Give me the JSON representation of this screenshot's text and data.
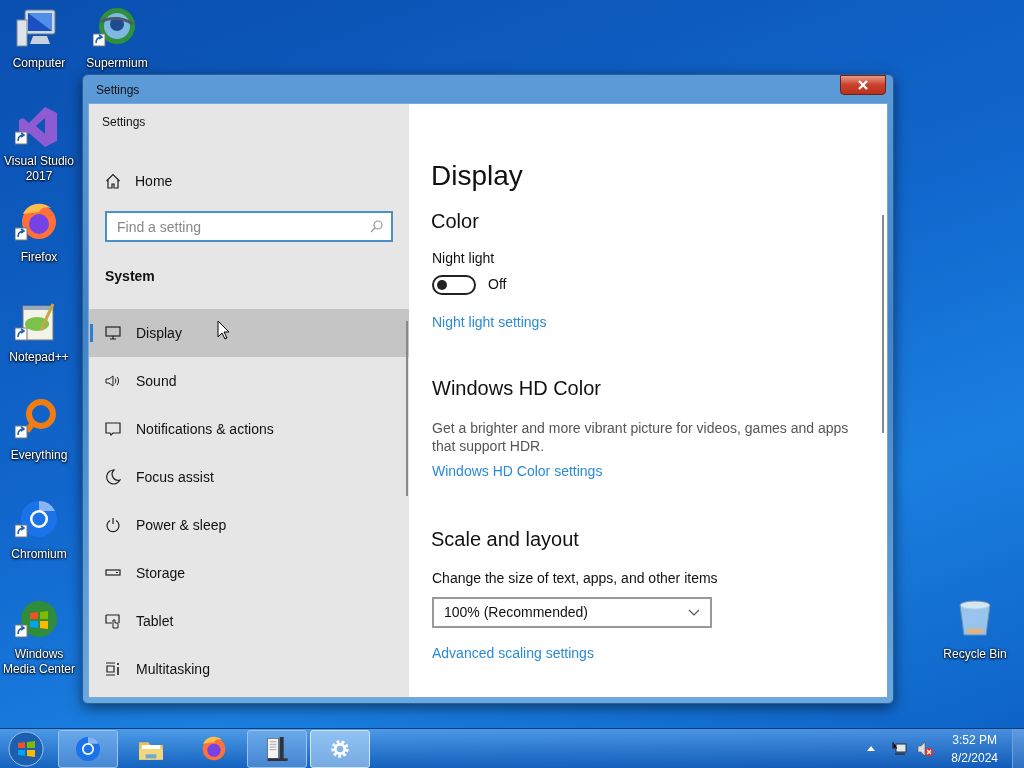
{
  "desktop_icons": [
    {
      "kind": "computer",
      "label": "Computer",
      "shortcut": false
    },
    {
      "kind": "globe",
      "label": "Supermium",
      "shortcut": true
    },
    {
      "kind": "vs",
      "label": "Visual Studio 2017",
      "shortcut": true
    },
    {
      "kind": "firefox",
      "label": "Firefox",
      "shortcut": true
    },
    {
      "kind": "notepad",
      "label": "Notepad++",
      "shortcut": true
    },
    {
      "kind": "ring",
      "label": "Everything",
      "shortcut": true
    },
    {
      "kind": "chromium",
      "label": "Chromium",
      "shortcut": true
    },
    {
      "kind": "wmc",
      "label": "Windows Media Center",
      "shortcut": true
    },
    {
      "kind": "bin",
      "label": "Recycle Bin",
      "shortcut": false
    }
  ],
  "window": {
    "title": "Settings",
    "app_title": "Settings",
    "home": "Home",
    "search": {
      "placeholder": "Find a setting"
    },
    "group": "System",
    "nav_items": [
      {
        "kind": "display",
        "label": "Display",
        "selected": true
      },
      {
        "kind": "sound",
        "label": "Sound",
        "selected": false
      },
      {
        "kind": "notifications",
        "label": "Notifications & actions",
        "selected": false
      },
      {
        "kind": "focus",
        "label": "Focus assist",
        "selected": false
      },
      {
        "kind": "power",
        "label": "Power & sleep",
        "selected": false
      },
      {
        "kind": "storage",
        "label": "Storage",
        "selected": false
      },
      {
        "kind": "tablet",
        "label": "Tablet",
        "selected": false
      },
      {
        "kind": "multitasking",
        "label": "Multitasking",
        "selected": false
      }
    ],
    "page_title": "Display",
    "color": {
      "heading": "Color",
      "night_light_label": "Night light",
      "night_light": {
        "on": false,
        "state_text": "Off"
      },
      "link": "Night light settings"
    },
    "hd_color": {
      "heading": "Windows HD Color",
      "description": "Get a brighter and more vibrant picture for videos, games and apps that support HDR.",
      "link": "Windows HD Color settings"
    },
    "scale": {
      "heading": "Scale and layout",
      "label": "Change the size of text, apps, and other items",
      "dropdown_value": "100% (Recommended)",
      "link": "Advanced scaling settings"
    }
  },
  "taskbar": {
    "items": [
      {
        "kind": "chromium",
        "running": true,
        "active": false
      },
      {
        "kind": "explorer",
        "running": false,
        "active": false
      },
      {
        "kind": "firefox",
        "running": false,
        "active": false
      },
      {
        "kind": "app",
        "running": true,
        "active": false
      },
      {
        "kind": "settings",
        "running": true,
        "active": true
      }
    ],
    "time": "3:52 PM",
    "date": "8/2/2024"
  }
}
